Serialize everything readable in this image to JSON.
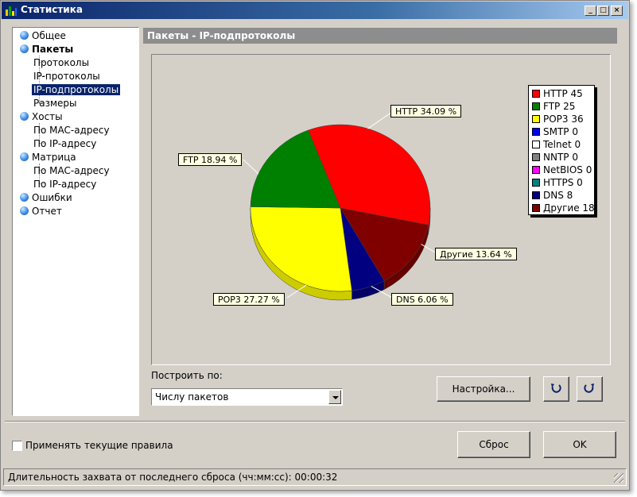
{
  "window": {
    "title": "Статистика"
  },
  "tree": {
    "items": [
      {
        "label": "Общее",
        "level": 0
      },
      {
        "label": "Пакеты",
        "level": 0,
        "bold": true
      },
      {
        "label": "Протоколы",
        "level": 1
      },
      {
        "label": "IP-протоколы",
        "level": 1
      },
      {
        "label": "IP-подпротоколы",
        "level": 1,
        "selected": true
      },
      {
        "label": "Размеры",
        "level": 1
      },
      {
        "label": "Хосты",
        "level": 0
      },
      {
        "label": "По MAC-адресу",
        "level": 1
      },
      {
        "label": "По IP-адресу",
        "level": 1
      },
      {
        "label": "Матрица",
        "level": 0
      },
      {
        "label": "По MAC-адресу",
        "level": 1
      },
      {
        "label": "По IP-адресу",
        "level": 1
      },
      {
        "label": "Ошибки",
        "level": 0
      },
      {
        "label": "Отчет",
        "level": 0
      }
    ]
  },
  "panel": {
    "title": "Пакеты - IP-подпротоколы"
  },
  "chart_data": {
    "type": "pie",
    "legend": [
      {
        "name": "HTTP",
        "value": 45,
        "color": "#ff0000"
      },
      {
        "name": "FTP",
        "value": 25,
        "color": "#008000"
      },
      {
        "name": "POP3",
        "value": 36,
        "color": "#ffff00"
      },
      {
        "name": "SMTP",
        "value": 0,
        "color": "#0000ff"
      },
      {
        "name": "Telnet",
        "value": 0,
        "color": "#ffffff"
      },
      {
        "name": "NNTP",
        "value": 0,
        "color": "#808080"
      },
      {
        "name": "NetBIOS",
        "value": 0,
        "color": "#ff00ff"
      },
      {
        "name": "HTTPS",
        "value": 0,
        "color": "#008080"
      },
      {
        "name": "DNS",
        "value": 8,
        "color": "#000080"
      },
      {
        "name": "Другие",
        "value": 18,
        "color": "#800000"
      }
    ],
    "slices": [
      {
        "name": "HTTP",
        "value": 45,
        "percent": 34.09,
        "color": "#ff0000",
        "label": "HTTP 34.09 %"
      },
      {
        "name": "Другие",
        "value": 18,
        "percent": 13.64,
        "color": "#800000",
        "label": "Другие 13.64 %"
      },
      {
        "name": "DNS",
        "value": 8,
        "percent": 6.06,
        "color": "#000080",
        "label": "DNS 6.06 %"
      },
      {
        "name": "POP3",
        "value": 36,
        "percent": 27.27,
        "color": "#ffff00",
        "label": "POP3 27.27 %"
      },
      {
        "name": "FTP",
        "value": 25,
        "percent": 18.94,
        "color": "#008000",
        "label": "FTP 18.94 %"
      }
    ]
  },
  "build_by": {
    "label": "Построить по:",
    "value": "Числу пакетов"
  },
  "buttons": {
    "settings": "Настройка...",
    "reset": "Сброс",
    "ok": "OK"
  },
  "apply_rules": {
    "label": "Применять текущие правила",
    "checked": false
  },
  "status": {
    "text": "Длительность захвата от последнего сброса (чч:мм:сс): 00:00:32"
  }
}
